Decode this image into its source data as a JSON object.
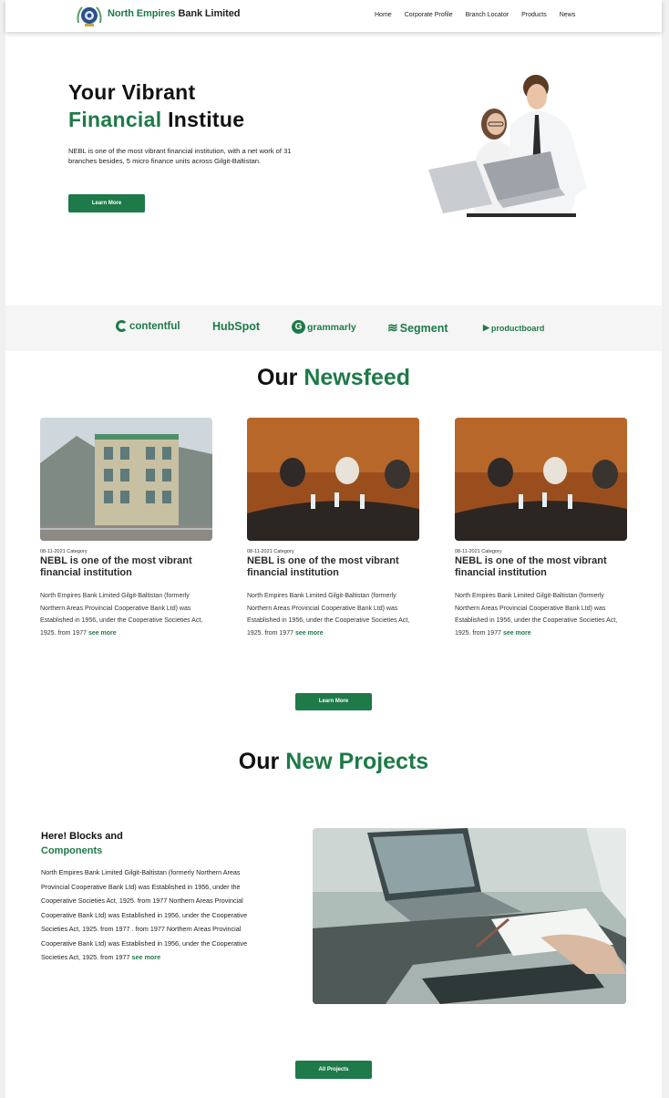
{
  "header": {
    "brand_green": "North Empires",
    "brand_dark": "Bank Limited",
    "nav": [
      "Home",
      "Corporate Profile",
      "Branch Locator",
      "Products",
      "News"
    ]
  },
  "hero": {
    "title_line1": "Your Vibrant",
    "title_green": "Financial",
    "title_rest": "Institue",
    "description": "NEBL is one of the most vibrant financial institution, with a net work of 31 branches besides, 5 micro finance units across Gilgit-Baltistan.",
    "button": "Learn More"
  },
  "partners": [
    "contentful",
    "HubSpot",
    "grammarly",
    "Segment",
    "productboard"
  ],
  "newsfeed": {
    "title_dark": "Our",
    "title_green": "Newsfeed",
    "cards": [
      {
        "meta": "08-11-2021 Category",
        "title": "NEBL is one of the most vibrant financial institution",
        "body": "North Empires Bank Limited Gilgit-Baltistan (formerly Northern Areas Provincial Cooperative Bank Ltd) was Established in 1956, under the Cooperative Societies Act, 1925. from 1977",
        "more": "see more"
      },
      {
        "meta": "08-11-2021 Category",
        "title": "NEBL is one of the most vibrant financial institution",
        "body": "North Empires Bank Limited Gilgit-Baltistan (formerly Northern Areas Provincial Cooperative Bank Ltd) was Established in 1956, under the Cooperative Societies Act, 1925. from 1977",
        "more": "see more"
      },
      {
        "meta": "08-11-2021 Category",
        "title": "NEBL is one of the most vibrant financial institution",
        "body": "North Empires Bank Limited Gilgit-Baltistan (formerly Northern Areas Provincial Cooperative Bank Ltd) was Established in 1956, under the Cooperative Societies Act, 1925. from 1977",
        "more": "see more"
      }
    ],
    "button": "Learn More"
  },
  "projects": {
    "title_dark": "Our",
    "title_green": "New Projects",
    "heading_line1": "Here! Blocks and",
    "heading_green": "Components",
    "body": "North Empires Bank Limited Gilgit-Baltistan (formerly Northern Areas Provincial Cooperative Bank Ltd) was Established in 1956, under the Cooperative Societies Act, 1925. from 1977 Northern Areas Provincial Cooperative Bank Ltd) was Established in 1956, under the Cooperative Societies Act, 1925. from 1977 . from 1977 Northern Areas Provincial Cooperative Bank Ltd) was Established in 1956, under the Cooperative Societies Act, 1925. from 1977",
    "more": "see more",
    "button": "All Projects"
  },
  "colors": {
    "brand_green": "#1e7a48"
  }
}
